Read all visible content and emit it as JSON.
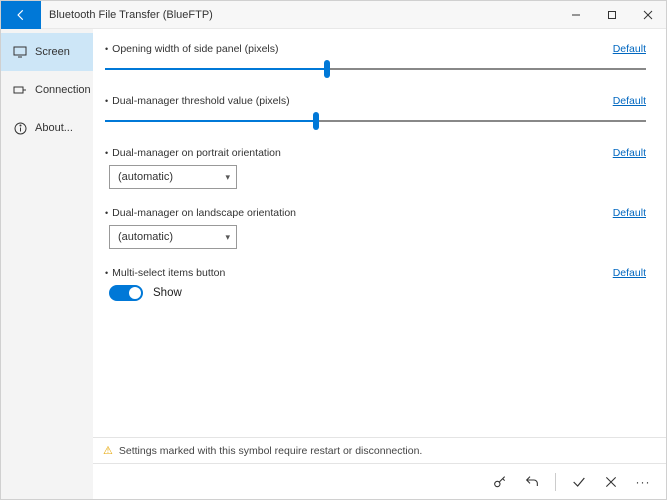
{
  "titlebar": {
    "title": "Bluetooth File Transfer (BlueFTP)"
  },
  "sidebar": {
    "items": [
      {
        "label": "Screen"
      },
      {
        "label": "Connection"
      },
      {
        "label": "About..."
      }
    ]
  },
  "settings": {
    "default_label": "Default",
    "opening_width": {
      "label": "Opening width of side panel (pixels)",
      "value_pct": 41
    },
    "dual_threshold": {
      "label": "Dual-manager threshold value (pixels)",
      "value_pct": 39
    },
    "portrait": {
      "label": "Dual-manager on portrait orientation",
      "selected": "(automatic)"
    },
    "landscape": {
      "label": "Dual-manager on landscape orientation",
      "selected": "(automatic)"
    },
    "multiselect": {
      "label": "Multi-select items button",
      "state_label": "Show"
    }
  },
  "footer": {
    "note": "Settings marked with this symbol require restart or disconnection."
  }
}
